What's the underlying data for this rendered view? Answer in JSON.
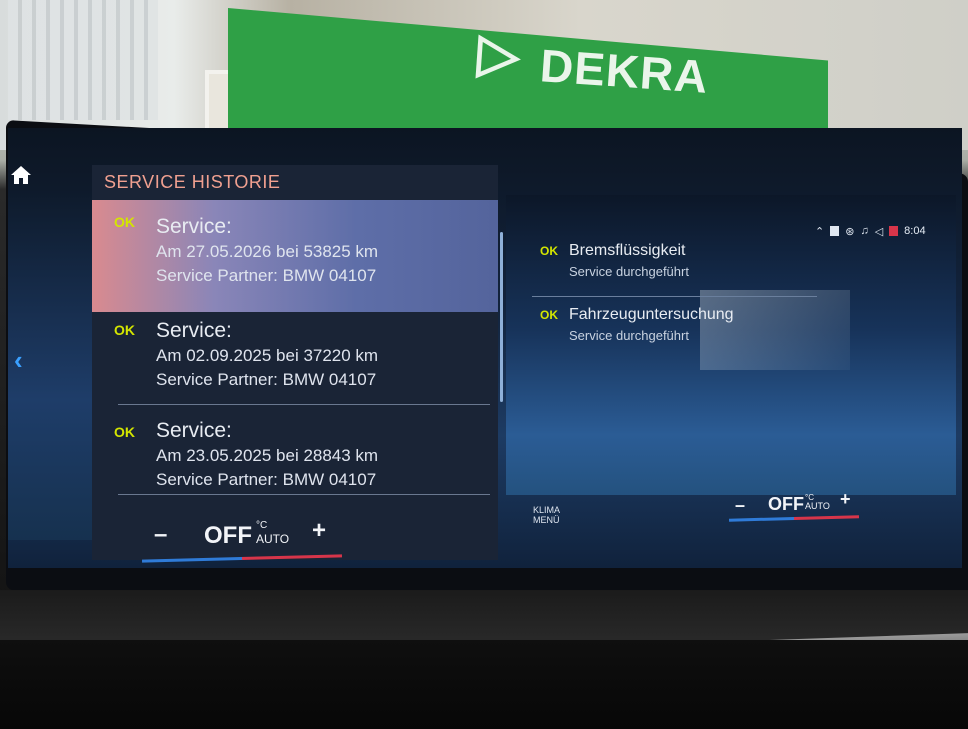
{
  "background": {
    "banner_text": "DEKRA",
    "banner_color": "#2fa046"
  },
  "display": {
    "home_icon": "home-icon",
    "left_nav_icon": "chevron-left-icon",
    "divider_nav_icon": "chevron-right-icon"
  },
  "service_history": {
    "title": "SERVICE HISTORIE",
    "items": [
      {
        "status": "OK",
        "title": "Service:",
        "date_line": "Am 27.05.2026 bei 53825 km",
        "partner_line": "Service Partner: BMW 04107",
        "selected": true
      },
      {
        "status": "OK",
        "title": "Service:",
        "date_line": "Am 02.09.2025 bei 37220 km",
        "partner_line": "Service Partner: BMW 04107",
        "selected": false
      },
      {
        "status": "OK",
        "title": "Service:",
        "date_line": "Am 23.05.2025 bei 28843 km",
        "partner_line": "Service Partner: BMW 04107",
        "selected": false
      }
    ]
  },
  "details": {
    "items": [
      {
        "status": "OK",
        "title": "Bremsflüssigkeit",
        "subtitle": "Service durchgeführt"
      },
      {
        "status": "OK",
        "title": "Fahrzeuguntersuchung",
        "subtitle": "Service durchgeführt"
      }
    ]
  },
  "status_bar": {
    "time": "8:04",
    "icons": [
      "chevron-up-icon",
      "battery-icon",
      "connectivity-icon",
      "music-icon",
      "volume-icon",
      "phone-icon"
    ]
  },
  "climate": {
    "left": {
      "minus": "–",
      "value": "OFF",
      "unit": "°C",
      "mode": "AUTO",
      "plus": "+"
    },
    "right": {
      "minus": "–",
      "value": "OFF",
      "unit": "°C",
      "mode": "AUTO",
      "plus": "+"
    },
    "menu_label_1": "KLIMA",
    "menu_label_2": "MENÜ",
    "color_cold": "#2f7bd8",
    "color_hot": "#d8354a"
  }
}
